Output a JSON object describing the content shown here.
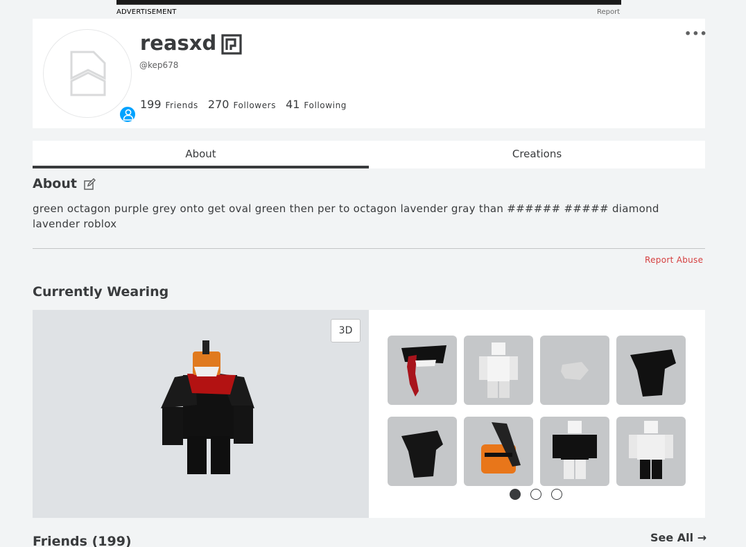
{
  "ad": {
    "label": "ADVERTISEMENT",
    "report": "Report"
  },
  "profile": {
    "display_name": "reasxd",
    "username": "@kep678",
    "stats": [
      {
        "count": "199",
        "label": "Friends"
      },
      {
        "count": "270",
        "label": "Followers"
      },
      {
        "count": "41",
        "label": "Following"
      }
    ],
    "more": "•••"
  },
  "tabs": [
    {
      "label": "About"
    },
    {
      "label": "Creations"
    }
  ],
  "about": {
    "title": "About",
    "text": "green octagon purple grey onto get oval green then per to octagon lavender gray than ###### ##### diamond lavender roblox",
    "report": "Report Abuse"
  },
  "wearing": {
    "title": "Currently Wearing",
    "btn_3d": "3D",
    "items": [
      {
        "icon": "red-tongue-mask-icon"
      },
      {
        "icon": "white-avatar-body-icon"
      },
      {
        "icon": "grey-accessory-icon"
      },
      {
        "icon": "black-shoulder-pad-icon"
      },
      {
        "icon": "black-shoulder-pad-icon"
      },
      {
        "icon": "orange-chainsaw-head-icon"
      },
      {
        "icon": "black-shirt-avatar-icon"
      },
      {
        "icon": "black-pants-avatar-icon"
      }
    ],
    "pages": 3,
    "active_page": 1
  },
  "friends": {
    "title": "Friends (199)",
    "see_all": "See All →"
  },
  "colors": {
    "accent_blue": "#00a2ff",
    "report_red": "#d53f3f",
    "text": "#393b3d"
  }
}
